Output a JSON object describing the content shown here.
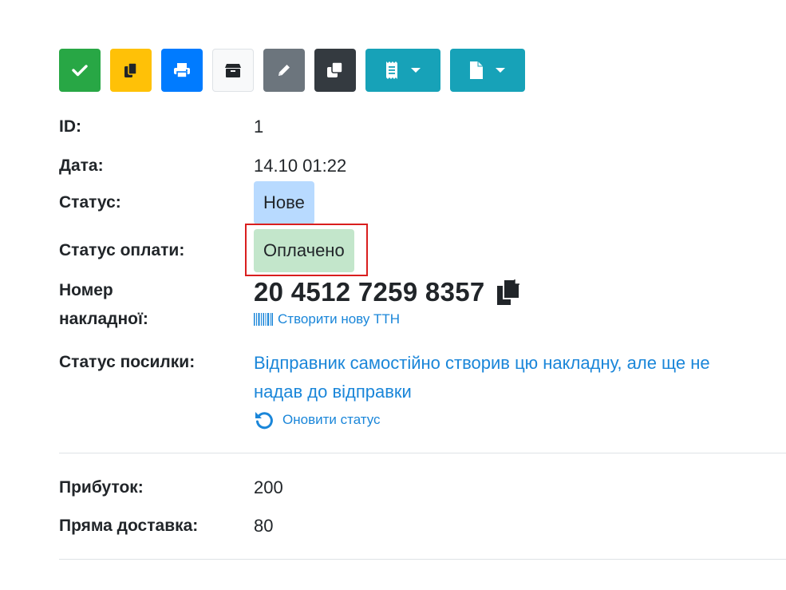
{
  "toolbar": {
    "buttons": [
      {
        "name": "confirm-button",
        "icon": "check-icon",
        "color": "#28a745"
      },
      {
        "name": "copy-button",
        "icon": "copy-icon",
        "color": "#ffc107"
      },
      {
        "name": "print-button",
        "icon": "print-icon",
        "color": "#007bff"
      },
      {
        "name": "archive-button",
        "icon": "box-icon",
        "color": "#f8f9fa"
      },
      {
        "name": "edit-button",
        "icon": "pencil-icon",
        "color": "#6c757d"
      },
      {
        "name": "clone-button",
        "icon": "clone-icon",
        "color": "#343a40"
      },
      {
        "name": "receipt-dropdown-button",
        "icon": "receipt-icon",
        "color": "#17a2b8"
      },
      {
        "name": "document-dropdown-button",
        "icon": "file-icon",
        "color": "#17a2b8"
      }
    ]
  },
  "order": {
    "id_label": "ID:",
    "id_value": "1",
    "date_label": "Дата:",
    "date_value": "14.10 01:22",
    "status_label": "Статус:",
    "status_value": "Нове",
    "payment_status_label": "Статус оплати:",
    "payment_status_value": "Оплачено",
    "waybill_label_line1": "Номер",
    "waybill_label_line2": "накладної:",
    "waybill_number": "20 4512 7259 8357",
    "create_ttn_link": "Створити нову ТТН",
    "parcel_status_label": "Статус посилки:",
    "parcel_status_line1": "Відправник самостійно створив цю накладну, але ще не",
    "parcel_status_line2": "надав до відправки",
    "refresh_status_link": "Оновити статус",
    "profit_label": "Прибуток:",
    "profit_value": "200",
    "direct_delivery_label": "Пряма доставка:",
    "direct_delivery_value": "80"
  },
  "colors": {
    "link": "#1a86d9",
    "status_badge": "#b8daff",
    "payment_badge": "#c3e6cb",
    "highlight": "#d91e1e"
  }
}
